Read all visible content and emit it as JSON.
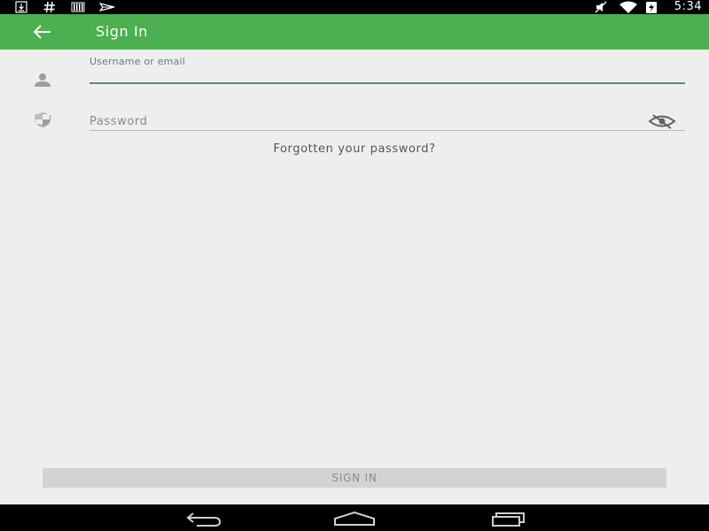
{
  "status_bar": {
    "time": "5:34",
    "left_icons": [
      "download-icon",
      "hash-icon",
      "barcode-icon",
      "send-icon"
    ],
    "right_icons": [
      "muted-icon",
      "wifi-icon",
      "battery-charging-icon"
    ]
  },
  "app_bar": {
    "back_icon": "arrow-back-icon",
    "title": "Sign In",
    "color": "#4caf50"
  },
  "form": {
    "username": {
      "label": "Username or email",
      "value": "",
      "icon": "person-icon"
    },
    "password": {
      "placeholder": "Password",
      "value": "",
      "icon": "shield-icon",
      "toggle_icon": "visibility-off-icon"
    },
    "forgot_link": "Forgotten your password?"
  },
  "sign_in_button": {
    "label": "SIGN IN",
    "enabled": false
  },
  "nav_bar": {
    "buttons": [
      "back-nav-icon",
      "home-nav-icon",
      "recents-nav-icon"
    ]
  }
}
